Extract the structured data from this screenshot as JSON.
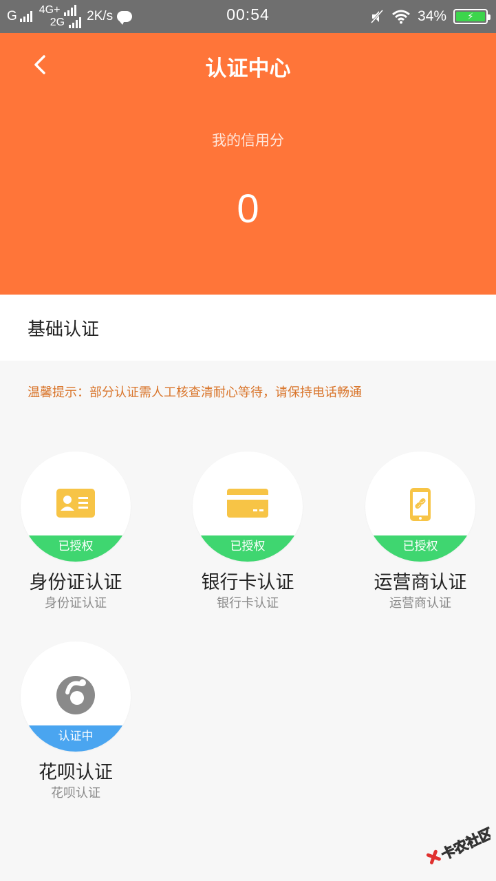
{
  "status_bar": {
    "carrier": "G",
    "net_top": "4G+",
    "net_bottom": "2G",
    "speed": "2K/s",
    "time": "00:54",
    "battery": "34%"
  },
  "header": {
    "title": "认证中心",
    "credit_label": "我的信用分",
    "credit_value": "0"
  },
  "section": {
    "title": "基础认证"
  },
  "tip": "温馨提示：部分认证需人工核查清耐心等待，请保持电话畅通",
  "cards": [
    {
      "title": "身份证认证",
      "subtitle": "身份证认证",
      "status": "已授权",
      "icon": "id-card-icon",
      "status_color": "#3fd670"
    },
    {
      "title": "银行卡认证",
      "subtitle": "银行卡认证",
      "status": "已授权",
      "icon": "bank-card-icon",
      "status_color": "#3fd670"
    },
    {
      "title": "运营商认证",
      "subtitle": "运营商认证",
      "status": "已授权",
      "icon": "phone-link-icon",
      "status_color": "#3fd670"
    },
    {
      "title": "花呗认证",
      "subtitle": "花呗认证",
      "status": "认证中",
      "icon": "huabei-icon",
      "status_color": "#4aa5f0"
    }
  ],
  "watermark": "卡农社区",
  "colors": {
    "header_bg": "#ff7539",
    "icon_yellow": "#f7c446",
    "tip_text": "#d9752b"
  }
}
